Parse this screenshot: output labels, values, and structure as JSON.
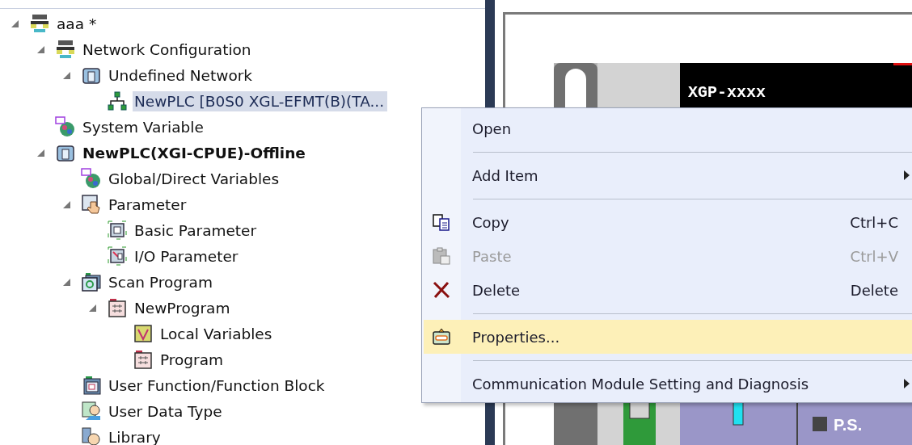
{
  "tree": [
    {
      "label": "aaa *",
      "kind": "network",
      "expanded": true,
      "selected": false,
      "children": [
        {
          "label": "Network Configuration",
          "kind": "network",
          "expanded": true,
          "selected": false,
          "active": false,
          "children": [
            {
              "label": "Undefined Network",
              "kind": "module",
              "expanded": true,
              "selected": false,
              "children": [
                {
                  "label": "NewPLC  [B0S0 XGL-EFMT(B)(TA...",
                  "kind": "topology",
                  "expanded": false,
                  "selected": true
                }
              ]
            }
          ]
        },
        {
          "label": "System Variable",
          "kind": "globe",
          "expanded": false,
          "selected": false,
          "active": false
        },
        {
          "label": "NewPLC(XGI-CPUE)-Offline",
          "kind": "module",
          "expanded": true,
          "selected": false,
          "active": true,
          "children": [
            {
              "label": "Global/Direct Variables",
              "kind": "globe",
              "expanded": false,
              "selected": false
            },
            {
              "label": "Parameter",
              "kind": "hand",
              "expanded": true,
              "selected": false,
              "children": [
                {
                  "label": "Basic Parameter",
                  "kind": "basic",
                  "expanded": false,
                  "selected": false
                },
                {
                  "label": "I/O Parameter",
                  "kind": "io",
                  "expanded": false,
                  "selected": false
                }
              ]
            },
            {
              "label": "Scan Program",
              "kind": "scan",
              "expanded": true,
              "selected": false,
              "children": [
                {
                  "label": "NewProgram",
                  "kind": "program",
                  "expanded": true,
                  "selected": false,
                  "children": [
                    {
                      "label": "Local Variables",
                      "kind": "variables",
                      "expanded": false,
                      "selected": false
                    },
                    {
                      "label": "Program",
                      "kind": "program",
                      "expanded": false,
                      "selected": false
                    }
                  ]
                }
              ]
            },
            {
              "label": "User Function/Function Block",
              "kind": "function",
              "expanded": false,
              "selected": false
            },
            {
              "label": "User Data Type",
              "kind": "user",
              "expanded": false,
              "selected": false
            },
            {
              "label": "Library",
              "kind": "library",
              "expanded": false,
              "selected": false
            }
          ]
        }
      ]
    }
  ],
  "canvas": {
    "module_label": "XGP-xxxx",
    "power_label": "P.S."
  },
  "context_menu": [
    {
      "kind": "plain",
      "label": "Open",
      "selected": false,
      "disabled": false,
      "submenu": false
    },
    {
      "kind": "separator"
    },
    {
      "kind": "plain",
      "label": "Add Item",
      "selected": false,
      "disabled": false,
      "submenu": true
    },
    {
      "kind": "separator"
    },
    {
      "kind": "copy",
      "label": "Copy",
      "shortcut": "Ctrl+C",
      "selected": false,
      "disabled": false,
      "submenu": false
    },
    {
      "kind": "paste",
      "label": "Paste",
      "shortcut": "Ctrl+V",
      "selected": false,
      "disabled": true,
      "submenu": false
    },
    {
      "kind": "delete",
      "label": "Delete",
      "shortcut": "Delete",
      "selected": false,
      "disabled": false,
      "submenu": false
    },
    {
      "kind": "separator"
    },
    {
      "kind": "properties",
      "label": "Properties...",
      "selected": true,
      "disabled": false,
      "submenu": false
    },
    {
      "kind": "separator"
    },
    {
      "kind": "plain",
      "label": "Communication Module Setting and Diagnosis",
      "selected": false,
      "disabled": false,
      "submenu": true
    }
  ]
}
